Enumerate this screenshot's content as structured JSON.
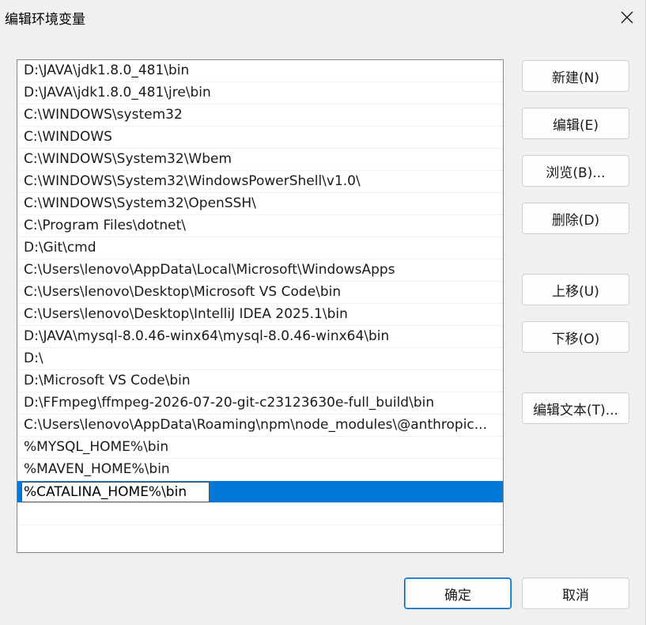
{
  "window": {
    "title": "编辑环境变量"
  },
  "path_list": {
    "items": [
      "D:\\JAVA\\jdk1.8.0_481\\bin",
      "D:\\JAVA\\jdk1.8.0_481\\jre\\bin",
      "C:\\WINDOWS\\system32",
      "C:\\WINDOWS",
      "C:\\WINDOWS\\System32\\Wbem",
      "C:\\WINDOWS\\System32\\WindowsPowerShell\\v1.0\\",
      "C:\\WINDOWS\\System32\\OpenSSH\\",
      "C:\\Program Files\\dotnet\\",
      "D:\\Git\\cmd",
      "C:\\Users\\lenovo\\AppData\\Local\\Microsoft\\WindowsApps",
      "C:\\Users\\lenovo\\Desktop\\Microsoft VS Code\\bin",
      "C:\\Users\\lenovo\\Desktop\\IntelliJ IDEA 2025.1\\bin",
      "D:\\JAVA\\mysql-8.0.46-winx64\\mysql-8.0.46-winx64\\bin",
      "D:\\",
      "D:\\Microsoft VS Code\\bin",
      "D:\\FFmpeg\\ffmpeg-2026-07-20-git-c23123630e-full_build\\bin",
      "C:\\Users\\lenovo\\AppData\\Roaming\\npm\\node_modules\\@anthropic...",
      "%MYSQL_HOME%\\bin",
      "%MAVEN_HOME%\\bin"
    ],
    "editing_value": "%CATALINA_HOME%\\bin"
  },
  "buttons": {
    "new": "新建(N)",
    "edit": "编辑(E)",
    "browse": "浏览(B)...",
    "delete": "删除(D)",
    "move_up": "上移(U)",
    "move_down": "下移(O)",
    "edit_text": "编辑文本(T)...",
    "ok": "确定",
    "cancel": "取消"
  },
  "colors": {
    "selection": "#0078d7",
    "primary_border": "#0067c0"
  }
}
